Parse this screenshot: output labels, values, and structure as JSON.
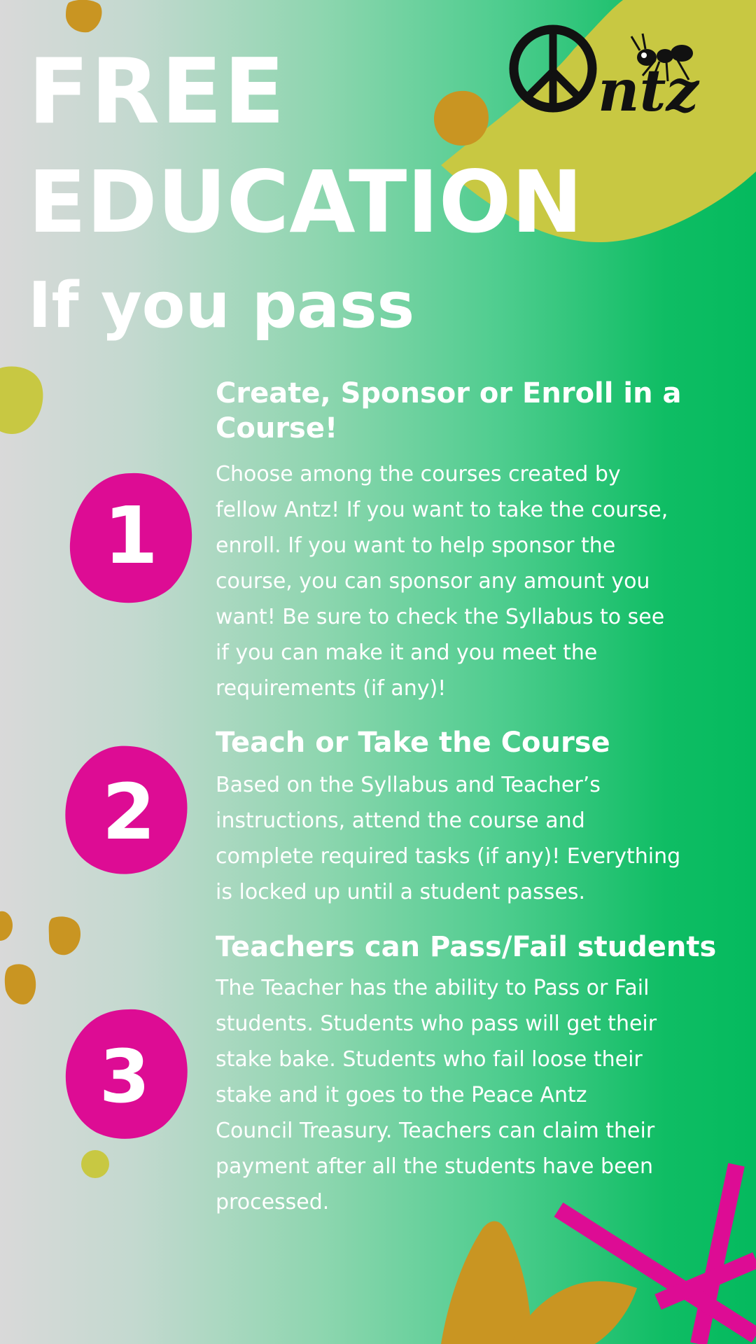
{
  "headline": {
    "line1": "FREE",
    "line2": "EDUCATION",
    "line3": "If you pass"
  },
  "logo": {
    "text": "ntz",
    "icon": "peace-sign-icon",
    "mascot": "ant-icon"
  },
  "steps": [
    {
      "number": "1",
      "title_line1": "Create, Sponsor or Enroll in a",
      "title_line2": "Course!",
      "body": [
        "Choose among the courses created by",
        "fellow Antz! If you want to take the course,",
        "enroll. If you want to help sponsor the",
        "course, you can sponsor any amount you",
        "want! Be sure to check the Syllabus to see",
        "if you can make it and you meet the",
        "requirements (if any)!"
      ]
    },
    {
      "number": "2",
      "title_line1": "Teach or Take the Course",
      "body": [
        "Based on the Syllabus and Teacher’s",
        "instructions, attend the course and",
        "complete required tasks (if any)! Everything",
        "is locked up until a student passes."
      ]
    },
    {
      "number": "3",
      "title_line1": "Teachers can Pass/Fail students",
      "body": [
        "The Teacher has the ability to Pass or Fail",
        "students. Students who pass will get their",
        "stake bake. Students who fail loose their",
        "stake and it goes to the Peace Antz",
        "Council Treasury. Teachers can claim their",
        "payment after all the students have been",
        "processed."
      ]
    }
  ],
  "colors": {
    "accent_magenta": "#dd0c94",
    "lime": "#c8c842",
    "mustard": "#c99522",
    "green": "#04ba5e",
    "text": "#ffffff"
  }
}
